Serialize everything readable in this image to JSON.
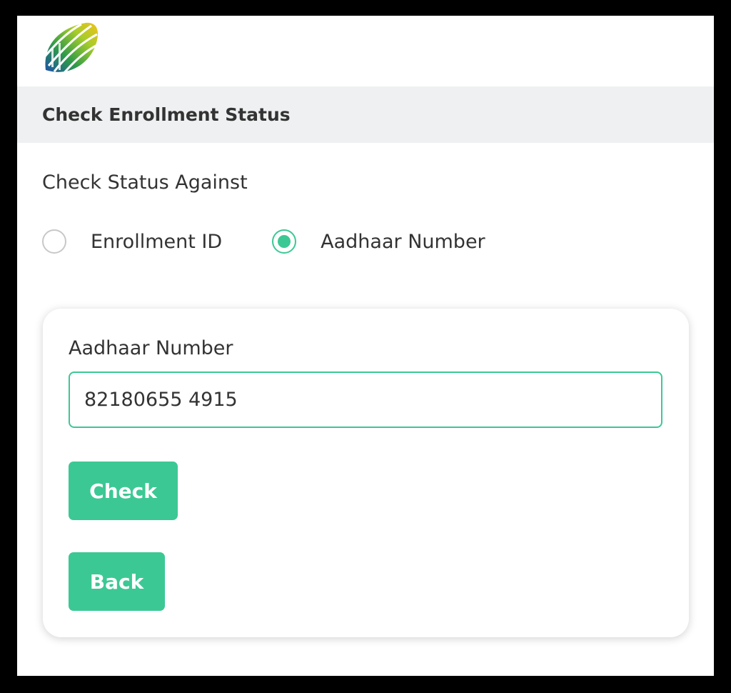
{
  "header": {
    "logo_icon": "leaf-logo-icon",
    "title": "Check Enrollment Status"
  },
  "form": {
    "section_label": "Check Status Against",
    "options": [
      {
        "label": "Enrollment ID",
        "selected": false
      },
      {
        "label": "Aadhaar Number",
        "selected": true
      }
    ],
    "field": {
      "label": "Aadhaar Number",
      "value": "82180655 4915"
    },
    "buttons": {
      "check_label": "Check",
      "back_label": "Back"
    }
  },
  "colors": {
    "accent": "#3cc894",
    "title_bar": "#eef0f1",
    "text": "#333333"
  }
}
